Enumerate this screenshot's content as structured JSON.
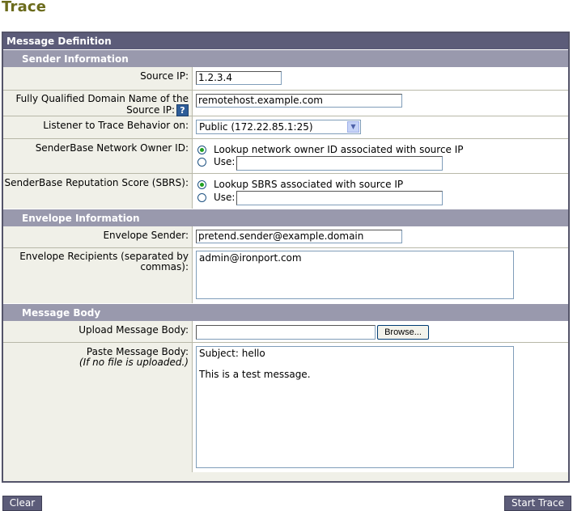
{
  "page": {
    "title": "Trace"
  },
  "panel": {
    "title": "Message Definition"
  },
  "sender": {
    "header": "Sender Information",
    "source_ip_label": "Source IP:",
    "source_ip_value": "1.2.3.4",
    "fqdn_label_line1": "Fully Qualified Domain Name of the",
    "fqdn_label_line2": "Source IP:",
    "fqdn_value": "remotehost.example.com",
    "help_glyph": "?",
    "listener_label": "Listener to Trace Behavior on:",
    "listener_value": "Public (172.22.85.1:25)",
    "owner_label": "SenderBase Network Owner ID:",
    "owner_option_lookup": "Lookup network owner ID associated with source IP",
    "owner_option_use": "Use:",
    "owner_use_value": "",
    "sbrs_label": "SenderBase Reputation Score (SBRS):",
    "sbrs_option_lookup": "Lookup SBRS associated with source IP",
    "sbrs_option_use": "Use:",
    "sbrs_use_value": ""
  },
  "envelope": {
    "header": "Envelope Information",
    "sender_label": "Envelope Sender:",
    "sender_value": "pretend.sender@example.domain",
    "recipients_label_line1": "Envelope Recipients (separated by",
    "recipients_label_line2": "commas):",
    "recipients_value": "admin@ironport.com"
  },
  "body": {
    "header": "Message Body",
    "upload_label": "Upload Message Body:",
    "upload_value": "",
    "browse_label": "Browse...",
    "paste_label": "Paste Message Body:",
    "paste_note": "(If no file is uploaded.)",
    "paste_value": "Subject: hello\n\nThis is a test message."
  },
  "actions": {
    "clear_label": "Clear",
    "start_label": "Start Trace"
  },
  "icons": {
    "dropdown": "chevron-down-icon",
    "help": "help-icon"
  },
  "colors": {
    "title": "#6b6b1c",
    "panel_header": "#5c5c79",
    "section_header": "#9999ad",
    "label_bg": "#f0f0e8"
  }
}
